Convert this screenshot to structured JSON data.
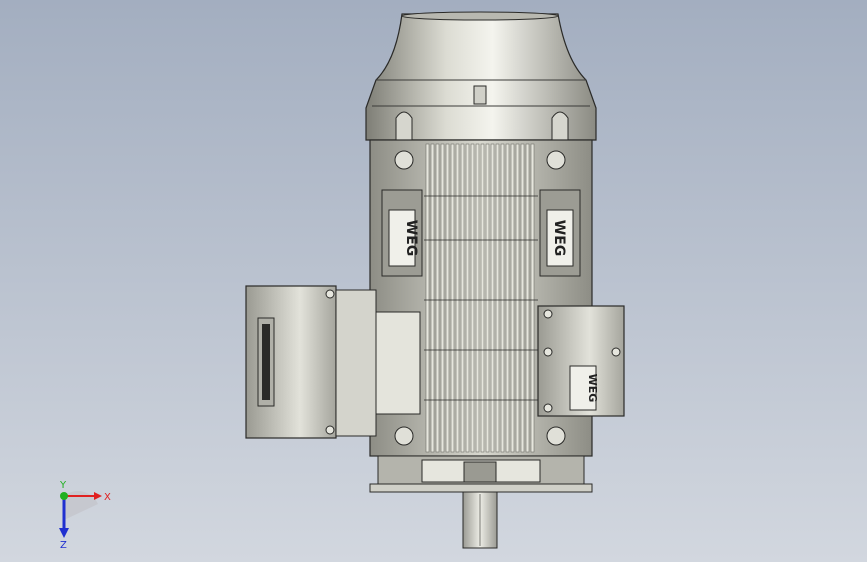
{
  "viewport": {
    "background_top": "#a3aec0",
    "background_bottom": "#d2d7df"
  },
  "model": {
    "nameplate_text": "WEG",
    "colors": {
      "body": "#c9c9bf",
      "body_dark": "#8f8f86",
      "fin": "#e6e6dd",
      "fin_gap": "#6e6e68",
      "outline": "#2a2a28"
    }
  },
  "triad": {
    "x_label": "X",
    "y_label": "Y",
    "z_label": "Z",
    "x_color": "#e02020",
    "y_color": "#20b020",
    "z_color": "#2030d0"
  }
}
